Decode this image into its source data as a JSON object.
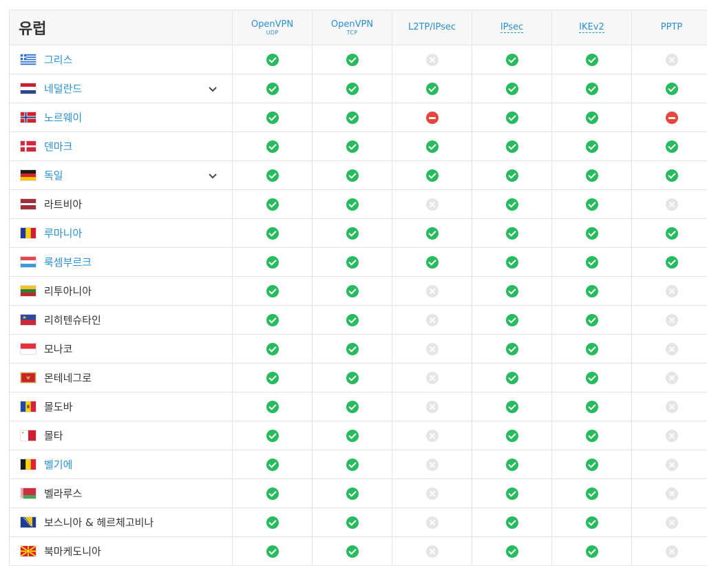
{
  "header": {
    "region": "유럽",
    "protocols": [
      {
        "label": "OpenVPN",
        "sub": "UDP",
        "dotted": false
      },
      {
        "label": "OpenVPN",
        "sub": "TCP",
        "dotted": false
      },
      {
        "label": "L2TP/IPsec",
        "sub": "",
        "dotted": false
      },
      {
        "label": "IPsec",
        "sub": "",
        "dotted": true
      },
      {
        "label": "IKEv2",
        "sub": "",
        "dotted": true
      },
      {
        "label": "PPTP",
        "sub": "",
        "dotted": false
      }
    ]
  },
  "status_legend": {
    "yes": "supported",
    "no": "unavailable",
    "block": "blocked"
  },
  "colors": {
    "accent": "#2a8fcf",
    "yes": "#27ba5e",
    "no": "#e5e5e5",
    "block": "#e8463c"
  },
  "rows": [
    {
      "name": "그리스",
      "link": true,
      "expand": false,
      "flag": "greece",
      "status": [
        "yes",
        "yes",
        "no",
        "yes",
        "yes",
        "no"
      ]
    },
    {
      "name": "네덜란드",
      "link": true,
      "expand": true,
      "flag": "netherlands",
      "status": [
        "yes",
        "yes",
        "yes",
        "yes",
        "yes",
        "yes"
      ]
    },
    {
      "name": "노르웨이",
      "link": true,
      "expand": false,
      "flag": "norway",
      "status": [
        "yes",
        "yes",
        "block",
        "yes",
        "yes",
        "block"
      ]
    },
    {
      "name": "덴마크",
      "link": true,
      "expand": false,
      "flag": "denmark",
      "status": [
        "yes",
        "yes",
        "yes",
        "yes",
        "yes",
        "yes"
      ]
    },
    {
      "name": "독일",
      "link": true,
      "expand": true,
      "flag": "germany",
      "status": [
        "yes",
        "yes",
        "yes",
        "yes",
        "yes",
        "yes"
      ]
    },
    {
      "name": "라트비아",
      "link": false,
      "expand": false,
      "flag": "latvia",
      "status": [
        "yes",
        "yes",
        "no",
        "yes",
        "yes",
        "no"
      ]
    },
    {
      "name": "루마니아",
      "link": true,
      "expand": false,
      "flag": "romania",
      "status": [
        "yes",
        "yes",
        "yes",
        "yes",
        "yes",
        "yes"
      ]
    },
    {
      "name": "룩셈부르크",
      "link": true,
      "expand": false,
      "flag": "luxembourg",
      "status": [
        "yes",
        "yes",
        "yes",
        "yes",
        "yes",
        "yes"
      ]
    },
    {
      "name": "리투아니아",
      "link": false,
      "expand": false,
      "flag": "lithuania",
      "status": [
        "yes",
        "yes",
        "no",
        "yes",
        "yes",
        "no"
      ]
    },
    {
      "name": "리히텐슈타인",
      "link": false,
      "expand": false,
      "flag": "liechtenstein",
      "status": [
        "yes",
        "yes",
        "no",
        "yes",
        "yes",
        "no"
      ]
    },
    {
      "name": "모나코",
      "link": false,
      "expand": false,
      "flag": "monaco",
      "status": [
        "yes",
        "yes",
        "no",
        "yes",
        "yes",
        "no"
      ]
    },
    {
      "name": "몬테네그로",
      "link": false,
      "expand": false,
      "flag": "montenegro",
      "status": [
        "yes",
        "yes",
        "no",
        "yes",
        "yes",
        "no"
      ]
    },
    {
      "name": "몰도바",
      "link": false,
      "expand": false,
      "flag": "moldova",
      "status": [
        "yes",
        "yes",
        "no",
        "yes",
        "yes",
        "no"
      ]
    },
    {
      "name": "몰타",
      "link": false,
      "expand": false,
      "flag": "malta",
      "status": [
        "yes",
        "yes",
        "no",
        "yes",
        "yes",
        "no"
      ]
    },
    {
      "name": "벨기에",
      "link": true,
      "expand": false,
      "flag": "belgium",
      "status": [
        "yes",
        "yes",
        "no",
        "yes",
        "yes",
        "no"
      ]
    },
    {
      "name": "벨라루스",
      "link": false,
      "expand": false,
      "flag": "belarus",
      "status": [
        "yes",
        "yes",
        "no",
        "yes",
        "yes",
        "no"
      ]
    },
    {
      "name": "보스니아 & 헤르체고비나",
      "link": false,
      "expand": false,
      "flag": "bosnia",
      "status": [
        "yes",
        "yes",
        "no",
        "yes",
        "yes",
        "no"
      ]
    },
    {
      "name": "북마케도니아",
      "link": false,
      "expand": false,
      "flag": "north-macedonia",
      "status": [
        "yes",
        "yes",
        "no",
        "yes",
        "yes",
        "no"
      ]
    }
  ]
}
